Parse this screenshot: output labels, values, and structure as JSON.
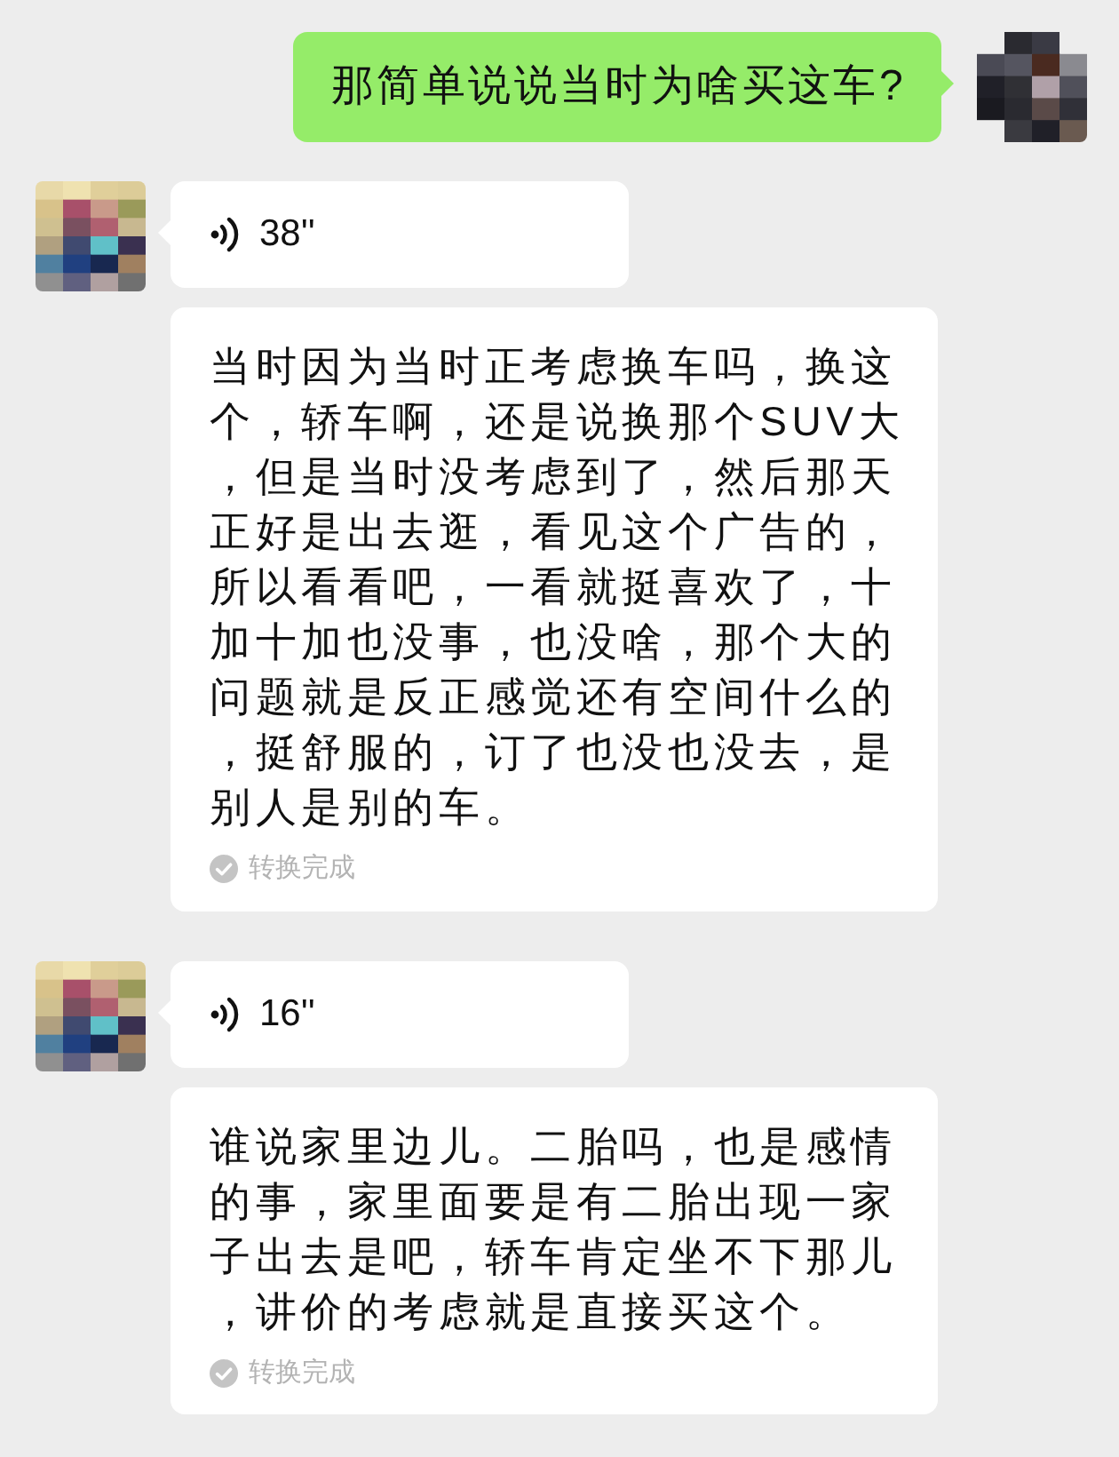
{
  "messages": [
    {
      "kind": "text",
      "outgoing": true,
      "text": "那简单说说当时为啥买这车?"
    },
    {
      "kind": "voice",
      "outgoing": false,
      "duration": "38''"
    },
    {
      "kind": "transcript",
      "outgoing": false,
      "lines": [
        "当时因为当时正考虑换车吗，换这",
        "个，轿车啊，还是说换那个SUV大",
        "，但是当时没考虑到了，然后那天",
        "正好是出去逛，看见这个广告的，",
        "所以看看吧，一看就挺喜欢了，十",
        "加十加也没事，也没啥，那个大的",
        "问题就是反正感觉还有空间什么的",
        "，挺舒服的，订了也没也没去，是",
        "别人是别的车。"
      ],
      "status": "转换完成"
    },
    {
      "kind": "voice",
      "outgoing": false,
      "duration": "16''"
    },
    {
      "kind": "transcript",
      "outgoing": false,
      "lines": [
        "谁说家里边儿。二胎吗，也是感情",
        "的事，家里面要是有二胎出现一家",
        "子出去是吧，轿车肯定坐不下那儿",
        "，讲价的考虑就是直接买这个。"
      ],
      "status": "转换完成"
    }
  ]
}
